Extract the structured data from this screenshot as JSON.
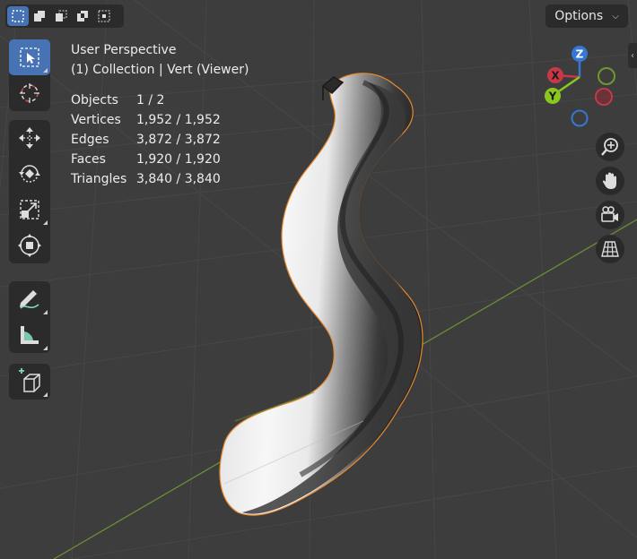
{
  "header": {
    "mode_icons": [
      "select-box-icon",
      "extend-selection-icon",
      "subtract-selection-icon",
      "invert-selection-icon",
      "intersect-selection-icon"
    ],
    "options_label": "Options"
  },
  "overlay": {
    "view_name": "User Perspective",
    "collection_line": "(1) Collection | Vert (Viewer)"
  },
  "stats": [
    {
      "label": "Objects",
      "value": "1 / 2"
    },
    {
      "label": "Vertices",
      "value": "1,952 / 1,952"
    },
    {
      "label": "Edges",
      "value": "3,872 / 3,872"
    },
    {
      "label": "Faces",
      "value": "1,920 / 1,920"
    },
    {
      "label": "Triangles",
      "value": "3,840 / 3,840"
    }
  ],
  "gizmo": {
    "z_label": "Z",
    "x_label": "X",
    "y_label": "Y",
    "colors": {
      "x": "#c93846",
      "y": "#8ac71f",
      "z": "#3478d4"
    }
  },
  "toolbar": {
    "tools": [
      "select-tool-icon",
      "cursor-tool-icon",
      "move-tool-icon",
      "rotate-tool-icon",
      "scale-tool-icon",
      "transform-tool-icon",
      "annotate-tool-icon",
      "measure-tool-icon",
      "add-cube-tool-icon"
    ]
  },
  "nav": [
    "zoom-icon",
    "pan-hand-icon",
    "camera-icon",
    "grid-perspective-icon"
  ],
  "colors": {
    "viewport_bg": "#3d3d3d",
    "panel_bg": "#2b2b2b",
    "accent": "#4772b3",
    "selection_outline": "#e8892c"
  }
}
